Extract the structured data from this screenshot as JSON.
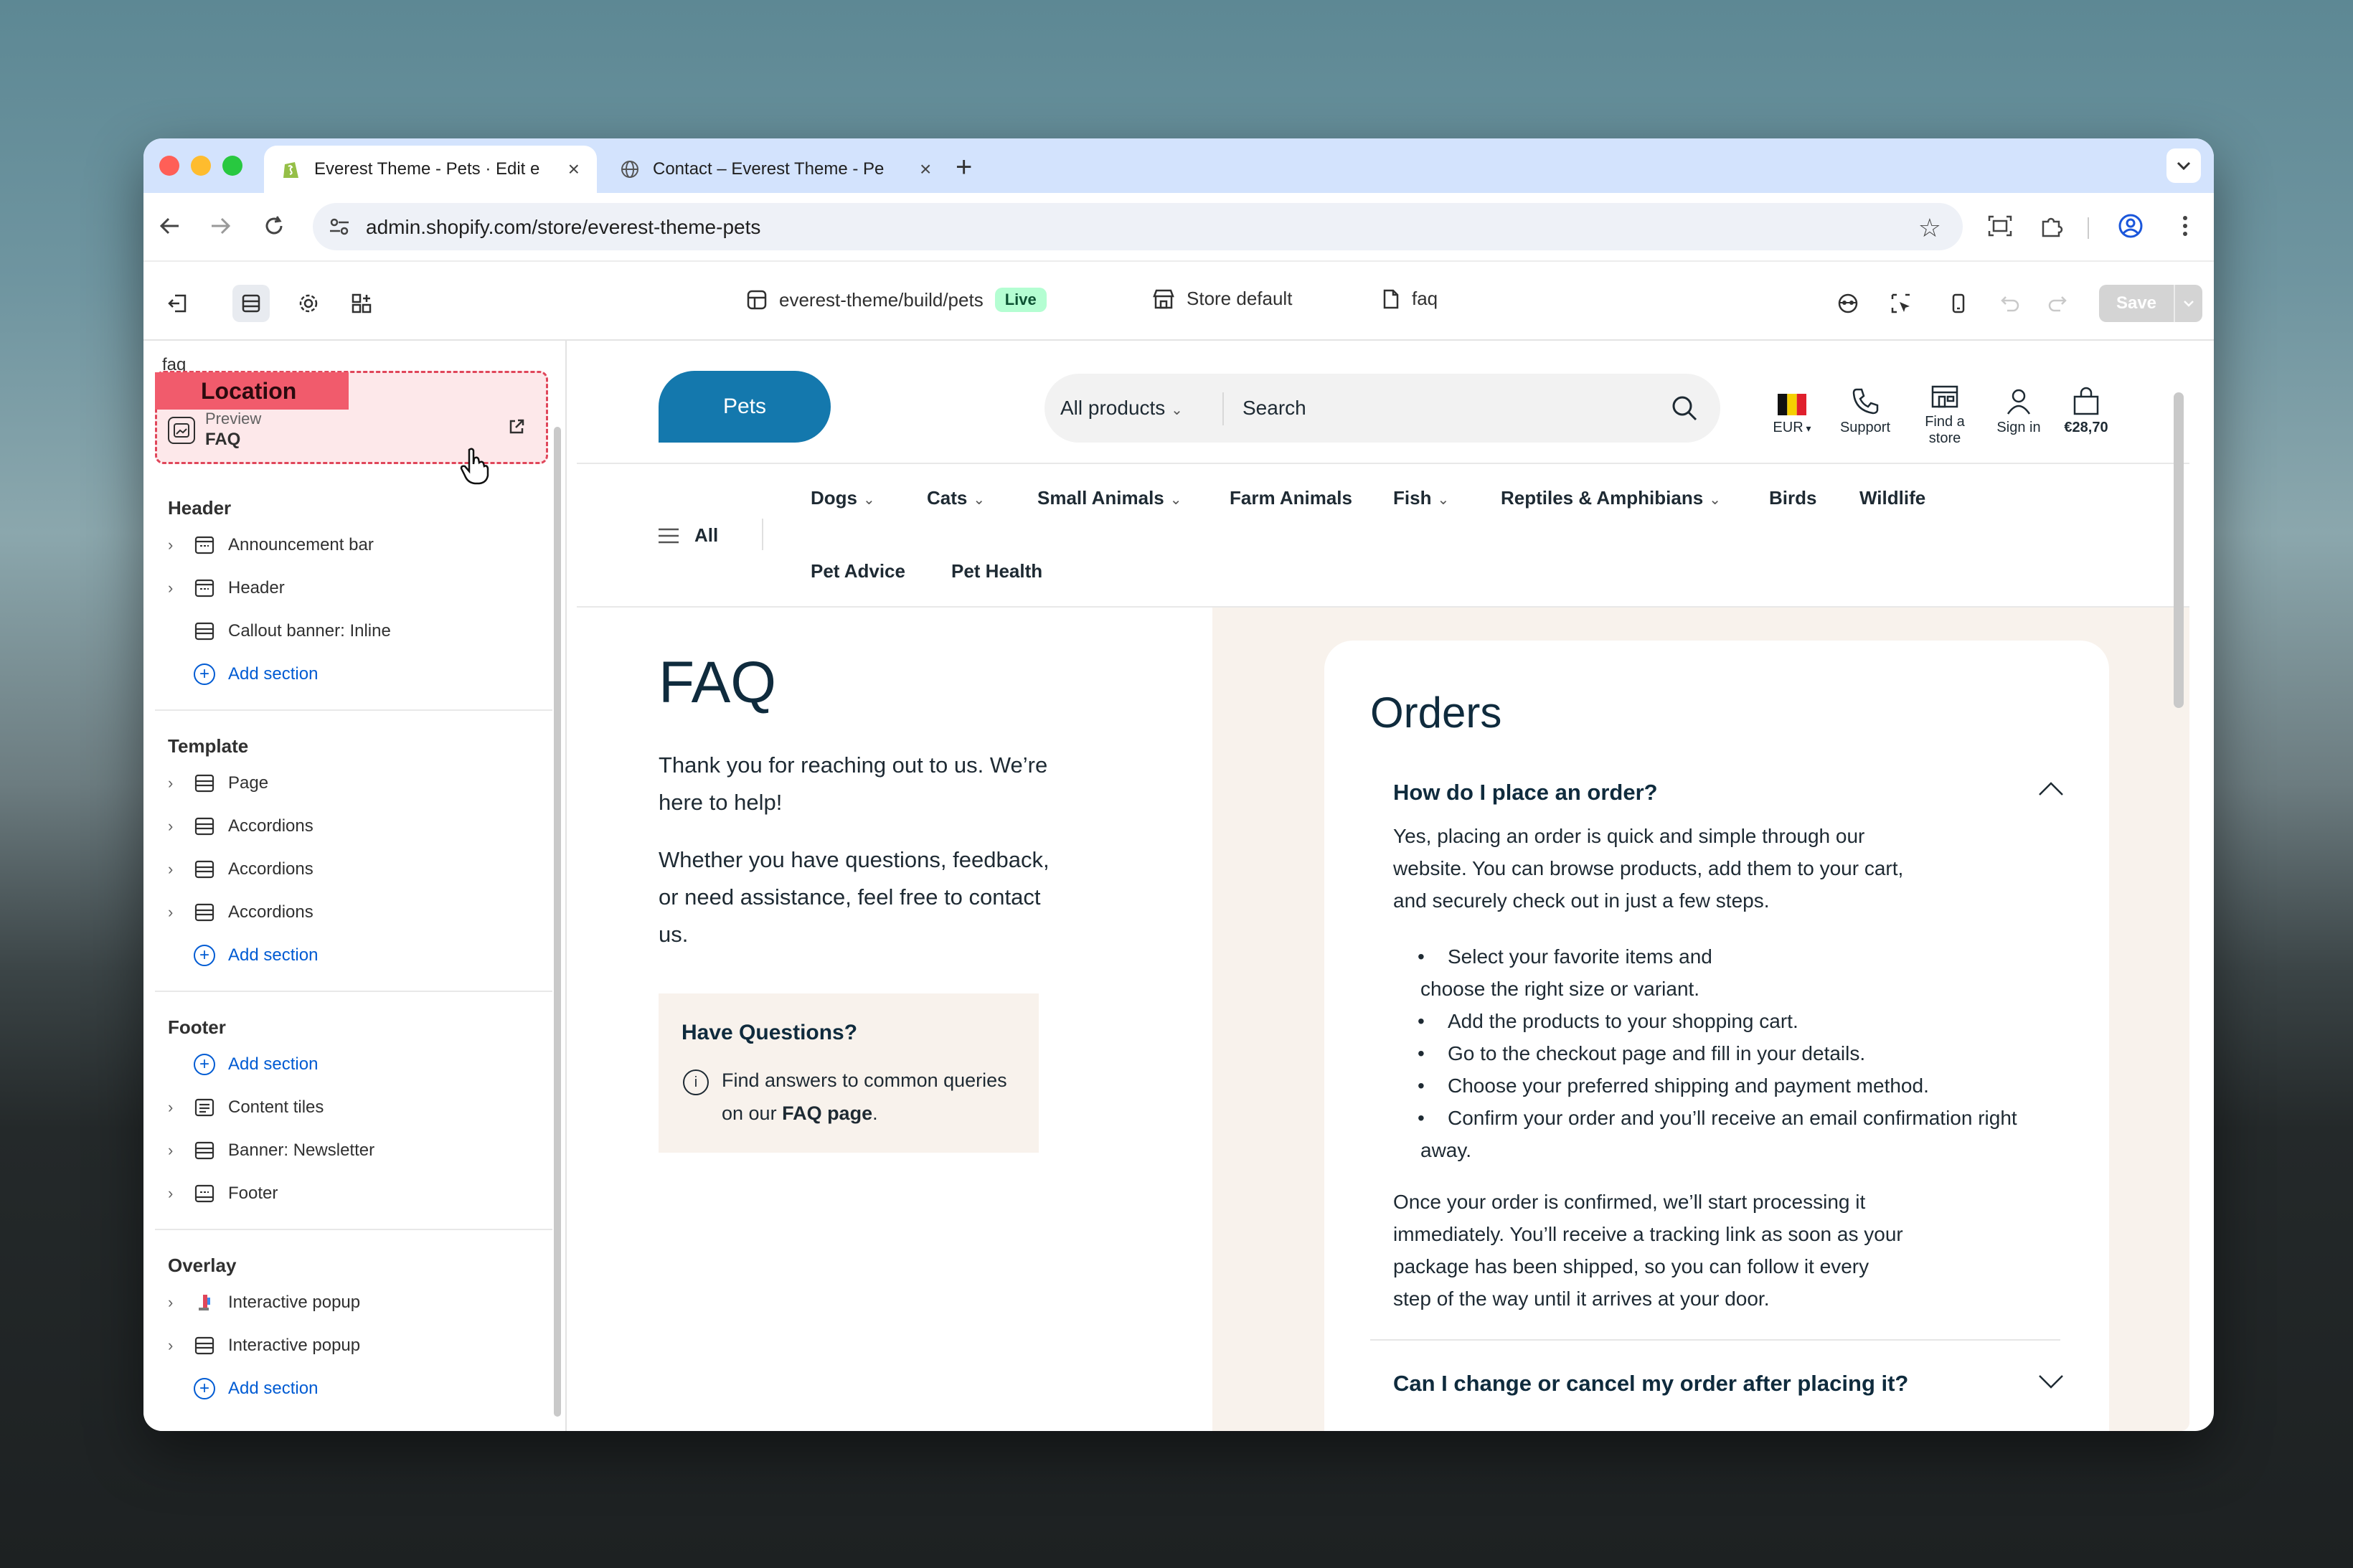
{
  "browser": {
    "tabs": [
      {
        "title": "Everest Theme - Pets · Edit e",
        "active": true
      },
      {
        "title": "Contact – Everest Theme - Pe",
        "active": false
      }
    ],
    "new_tab": "+",
    "close": "×",
    "url": "admin.shopify.com/store/everest-theme-pets"
  },
  "editor": {
    "theme_path": "everest-theme/build/pets",
    "live_badge": "Live",
    "store_default": "Store default",
    "page": "faq",
    "save": "Save"
  },
  "sidebar": {
    "faq_top": "faq",
    "location_tag": "Location",
    "preview_label": "Preview",
    "preview_value": "FAQ",
    "groups": {
      "header": {
        "title": "Header",
        "items": [
          "Announcement bar",
          "Header",
          "Callout banner: Inline"
        ],
        "add": "Add section"
      },
      "template": {
        "title": "Template",
        "items": [
          "Page",
          "Accordions",
          "Accordions",
          "Accordions"
        ],
        "add": "Add section"
      },
      "footer": {
        "title": "Footer",
        "add": "Add section",
        "items": [
          "Content tiles",
          "Banner: Newsletter",
          "Footer"
        ]
      },
      "overlay": {
        "title": "Overlay",
        "items": [
          "Interactive popup",
          "Interactive popup"
        ],
        "add": "Add section"
      }
    }
  },
  "store": {
    "logo": "Pets",
    "search_category": "All products",
    "search_placeholder": "Search",
    "currency": "EUR",
    "support": "Support",
    "find_store_1": "Find a",
    "find_store_2": "store",
    "sign_in": "Sign in",
    "cart_total": "€28,70",
    "nav_all": "All",
    "nav": [
      "Dogs",
      "Cats",
      "Small Animals",
      "Farm Animals",
      "Fish",
      "Reptiles & Amphibians",
      "Birds",
      "Wildlife",
      "Pet Advice",
      "Pet Health"
    ],
    "faq_title": "FAQ",
    "faq_p1": "Thank you for reaching out to us. We’re here to help!",
    "faq_p2": "Whether you have questions, feedback, or need assistance, feel free to contact us.",
    "have_questions": "Have Questions?",
    "hq_text_pre": "Find answers to common queries on our ",
    "hq_link": "FAQ page",
    "hq_text_post": ".",
    "orders_title": "Orders",
    "q1": "How do I place an order?",
    "a1_intro": "Yes, placing an order is quick and simple through our website. You can browse products, add them to your cart, and securely check out in just a few steps.",
    "a1_list": [
      "Select your favorite items and choose the right size or variant.",
      "Add the products to your shopping cart.",
      "Go to the checkout page and fill in your details.",
      "Choose your preferred shipping and payment method.",
      "Confirm your order and you’ll receive an email confirmation right away."
    ],
    "a1_outro": "Once your order is confirmed, we’ll start processing it immediately. You’ll receive a tracking link as soon as your package has been shipped, so you can follow it every step of the way until it arrives at your door.",
    "q2": "Can I change or cancel my order after placing it?"
  },
  "colors": {
    "brand_blue": "#1478ad",
    "location_red": "#f15b6c",
    "link_blue": "#005bd3",
    "live_green": "#b4fed2"
  }
}
